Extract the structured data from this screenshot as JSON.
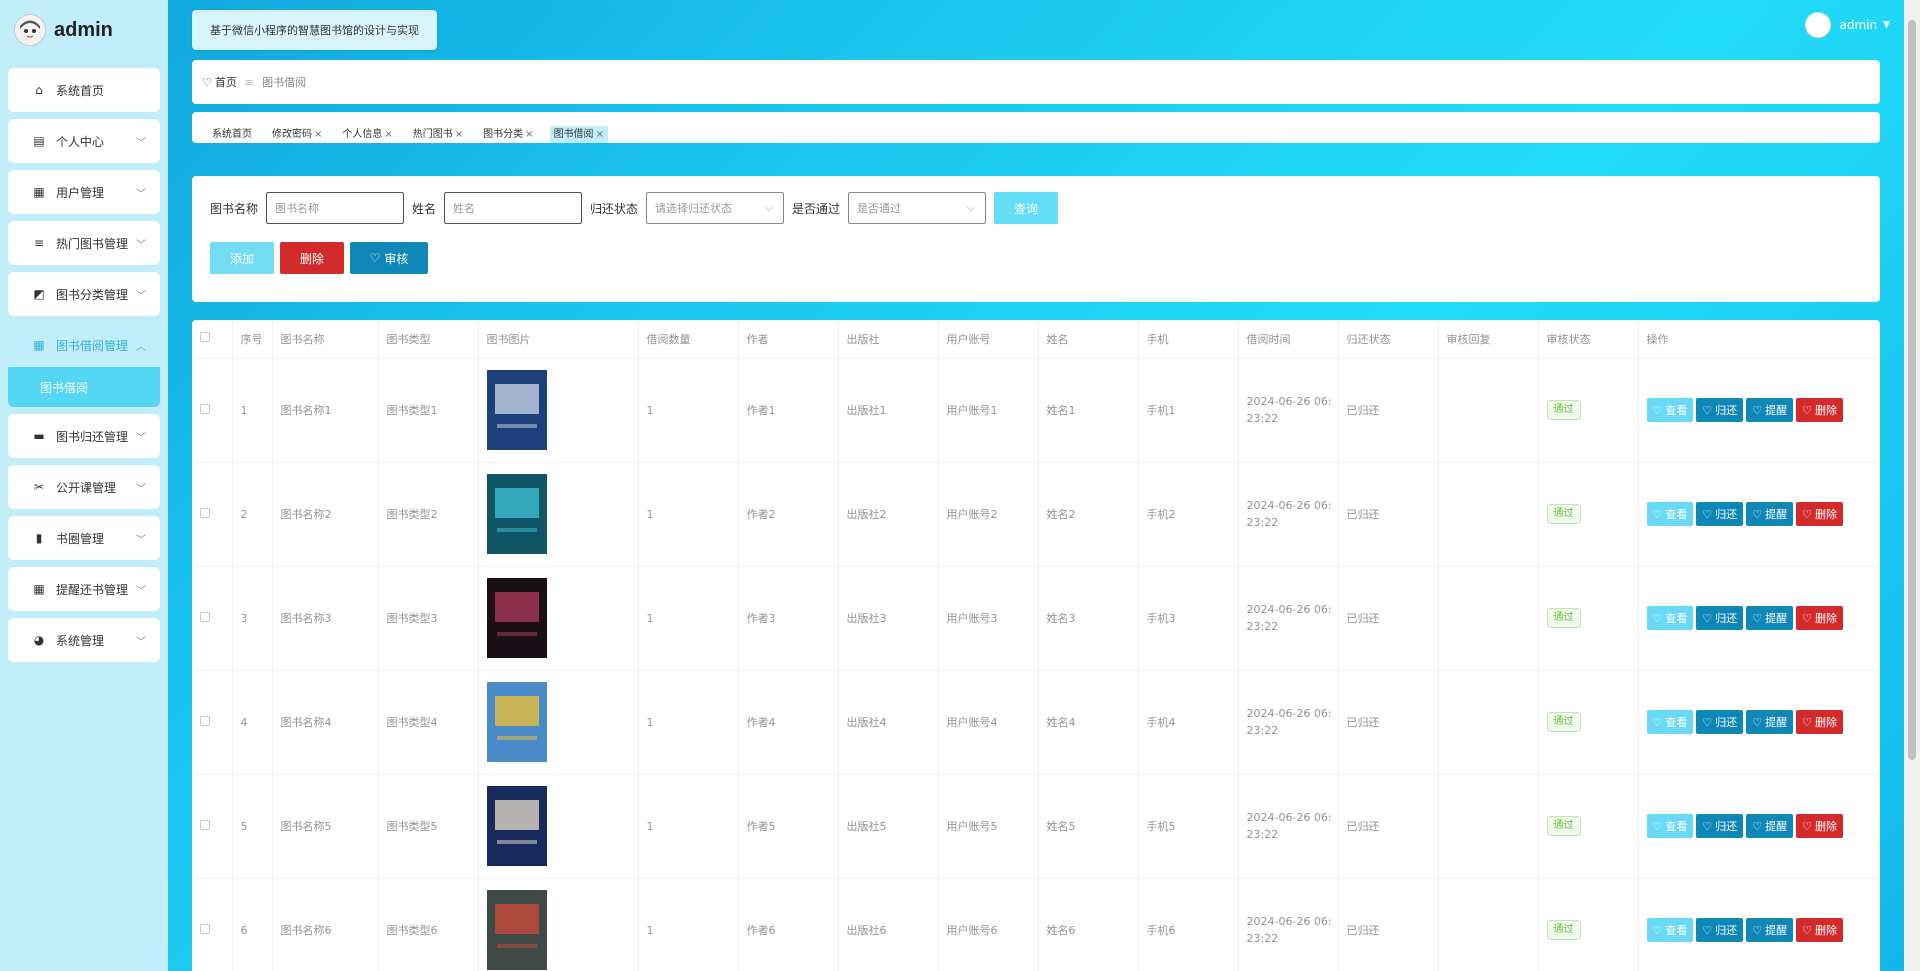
{
  "brand": {
    "name": "admin"
  },
  "header": {
    "system_title": "基于微信小程序的智慧图书馆的设计与实现",
    "user_name": "admin"
  },
  "sidebar": {
    "items": [
      {
        "label": "系统首页",
        "icon": "home-icon",
        "glyph": "⌂",
        "expandable": false
      },
      {
        "label": "个人中心",
        "icon": "id-card-icon",
        "glyph": "▤",
        "expandable": true
      },
      {
        "label": "用户管理",
        "icon": "grid-icon",
        "glyph": "▦",
        "expandable": true
      },
      {
        "label": "热门图书管理",
        "icon": "sliders-icon",
        "glyph": "≡",
        "expandable": true
      },
      {
        "label": "图书分类管理",
        "icon": "chart-icon",
        "glyph": "◩",
        "expandable": true
      },
      {
        "label": "图书借阅管理",
        "icon": "grid-icon",
        "glyph": "▦",
        "expandable": true,
        "active": true
      },
      {
        "label": "图书归还管理",
        "icon": "monitor-icon",
        "glyph": "▬",
        "expandable": true
      },
      {
        "label": "公开课管理",
        "icon": "ticket-icon",
        "glyph": "✂",
        "expandable": true
      },
      {
        "label": "书圈管理",
        "icon": "bar-chart-icon",
        "glyph": "▮",
        "expandable": true
      },
      {
        "label": "提醒还书管理",
        "icon": "grid-icon",
        "glyph": "▦",
        "expandable": true
      },
      {
        "label": "系统管理",
        "icon": "palette-icon",
        "glyph": "◕",
        "expandable": true
      }
    ],
    "active_sub_item": "图书借阅"
  },
  "breadcrumb": {
    "home": "首页",
    "separator": "≡",
    "current": "图书借阅"
  },
  "tags": [
    {
      "label": "系统首页",
      "closable": false
    },
    {
      "label": "修改密码",
      "closable": true
    },
    {
      "label": "个人信息",
      "closable": true
    },
    {
      "label": "热门图书",
      "closable": true
    },
    {
      "label": "图书分类",
      "closable": true
    },
    {
      "label": "图书借阅",
      "closable": true,
      "active": true
    }
  ],
  "filter": {
    "book_name_label": "图书名称",
    "book_name_placeholder": "图书名称",
    "name_label": "姓名",
    "name_placeholder": "姓名",
    "return_status_label": "归还状态",
    "return_status_placeholder": "请选择归还状态",
    "approved_label": "是否通过",
    "approved_placeholder": "是否通过",
    "query_label": "查询",
    "add_label": "添加",
    "delete_label": "删除",
    "audit_label": "审核"
  },
  "table": {
    "columns": [
      "序号",
      "图书名称",
      "图书类型",
      "图书图片",
      "借阅数量",
      "作者",
      "出版社",
      "用户账号",
      "姓名",
      "手机",
      "借阅时间",
      "归还状态",
      "审核回复",
      "审核状态",
      "操作"
    ],
    "op_labels": {
      "view": "查看",
      "return": "归还",
      "remind": "提醒",
      "delete": "删除"
    },
    "rows": [
      {
        "index": "1",
        "book_name": "图书名称1",
        "book_type": "图书类型1",
        "qty": "1",
        "author": "作者1",
        "publisher": "出版社1",
        "account": "用户账号1",
        "name": "姓名1",
        "phone": "手机1",
        "time_line1": "2024-06-26 06:",
        "time_line2": "23:22",
        "return_status": "已归还",
        "reply": "",
        "audit_status": "通过",
        "cover_color": "#1d3f7a",
        "cover_accent": "#cfd8e8"
      },
      {
        "index": "2",
        "book_name": "图书名称2",
        "book_type": "图书类型2",
        "qty": "1",
        "author": "作者2",
        "publisher": "出版社2",
        "account": "用户账号2",
        "name": "姓名2",
        "phone": "手机2",
        "time_line1": "2024-06-26 06:",
        "time_line2": "23:22",
        "return_status": "已归还",
        "reply": "",
        "audit_status": "通过",
        "cover_color": "#0f5566",
        "cover_accent": "#42c3d6"
      },
      {
        "index": "3",
        "book_name": "图书名称3",
        "book_type": "图书类型3",
        "qty": "1",
        "author": "作者3",
        "publisher": "出版社3",
        "account": "用户账号3",
        "name": "姓名3",
        "phone": "手机3",
        "time_line1": "2024-06-26 06:",
        "time_line2": "23:22",
        "return_status": "已归还",
        "reply": "",
        "audit_status": "通过",
        "cover_color": "#1a1016",
        "cover_accent": "#b03a5e"
      },
      {
        "index": "4",
        "book_name": "图书名称4",
        "book_type": "图书类型4",
        "qty": "1",
        "author": "作者4",
        "publisher": "出版社4",
        "account": "用户账号4",
        "name": "姓名4",
        "phone": "手机4",
        "time_line1": "2024-06-26 06:",
        "time_line2": "23:22",
        "return_status": "已归还",
        "reply": "",
        "audit_status": "通过",
        "cover_color": "#4a8ac9",
        "cover_accent": "#f2c230"
      },
      {
        "index": "5",
        "book_name": "图书名称5",
        "book_type": "图书类型5",
        "qty": "1",
        "author": "作者5",
        "publisher": "出版社5",
        "account": "用户账号5",
        "name": "姓名5",
        "phone": "手机5",
        "time_line1": "2024-06-26 06:",
        "time_line2": "23:22",
        "return_status": "已归还",
        "reply": "",
        "audit_status": "通过",
        "cover_color": "#182a5c",
        "cover_accent": "#e8e1cf"
      },
      {
        "index": "6",
        "book_name": "图书名称6",
        "book_type": "图书类型6",
        "qty": "1",
        "author": "作者6",
        "publisher": "出版社6",
        "account": "用户账号6",
        "name": "姓名6",
        "phone": "手机6",
        "time_line1": "2024-06-26 06:",
        "time_line2": "23:22",
        "return_status": "已归还",
        "reply": "",
        "audit_status": "通过",
        "cover_color": "#3f4a47",
        "cover_accent": "#d04a3a"
      }
    ]
  }
}
